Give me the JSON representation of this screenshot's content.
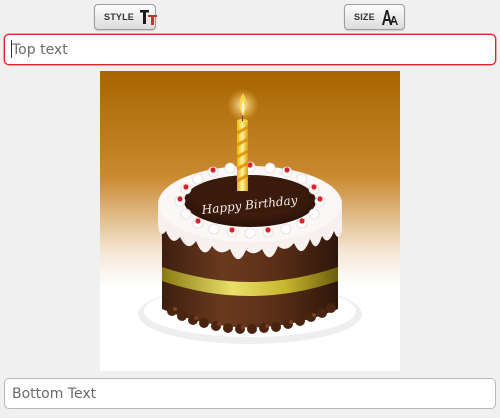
{
  "toolbar": {
    "style_label": "STYLE",
    "style_icon": "text-style-icon",
    "size_label": "SIZE",
    "size_icon": "font-size-icon"
  },
  "top_text": {
    "value": "",
    "placeholder": "Top text"
  },
  "image": {
    "description_icon": "birthday-cake-image",
    "cake_text": "Happy Birthday"
  },
  "bottom_text": {
    "value": "",
    "placeholder": "Bottom Text"
  },
  "colors": {
    "accent_border": "#d9262c",
    "background": "#f0f0f0"
  }
}
